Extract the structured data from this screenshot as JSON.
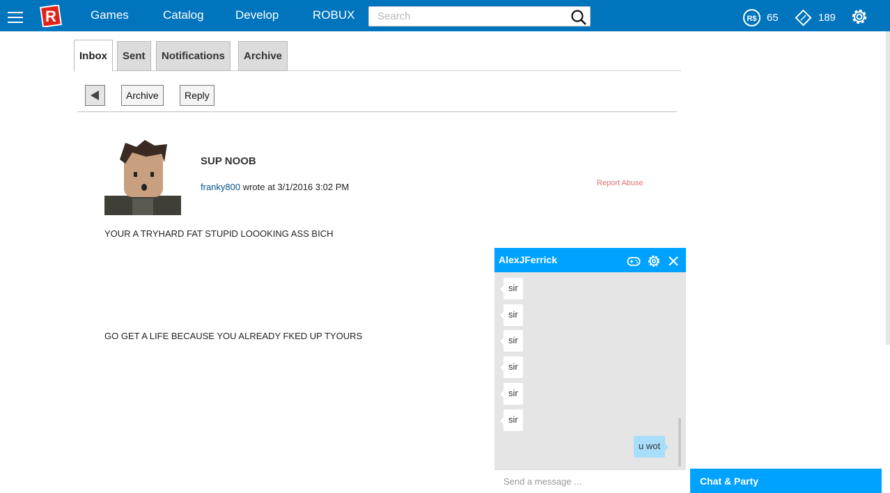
{
  "nav": {
    "links": [
      "Games",
      "Catalog",
      "Develop",
      "ROBUX"
    ],
    "search_placeholder": "Search",
    "robux": "65",
    "tickets": "189"
  },
  "tabs": [
    "Inbox",
    "Sent",
    "Notifications",
    "Archive"
  ],
  "toolbar": {
    "archive_label": "Archive",
    "reply_label": "Reply"
  },
  "message": {
    "subject": "SUP NOOB",
    "author": "franky800",
    "meta_suffix": " wrote at 3/1/2016 3:02 PM",
    "report_label": "Report Abuse",
    "body": [
      "YOUR A TRYHARD FAT STUPID LOOOKING ASS BICH",
      "GO GET A LIFE BECAUSE YOU ALREADY FKED UP TYOURS"
    ]
  },
  "chat": {
    "title": "AlexJFerrick",
    "messages": [
      {
        "text": "sir",
        "dir": "in"
      },
      {
        "text": "sir",
        "dir": "in"
      },
      {
        "text": "sir",
        "dir": "in"
      },
      {
        "text": "sir",
        "dir": "in"
      },
      {
        "text": "sir",
        "dir": "in"
      },
      {
        "text": "sir",
        "dir": "in"
      },
      {
        "text": "u wot",
        "dir": "out"
      }
    ],
    "input_placeholder": "Send a message ..."
  },
  "chat_party_label": "Chat & Party",
  "colors": {
    "topbar": "#0074bd",
    "chat_accent": "#00a2ff",
    "report": "#e07070"
  }
}
